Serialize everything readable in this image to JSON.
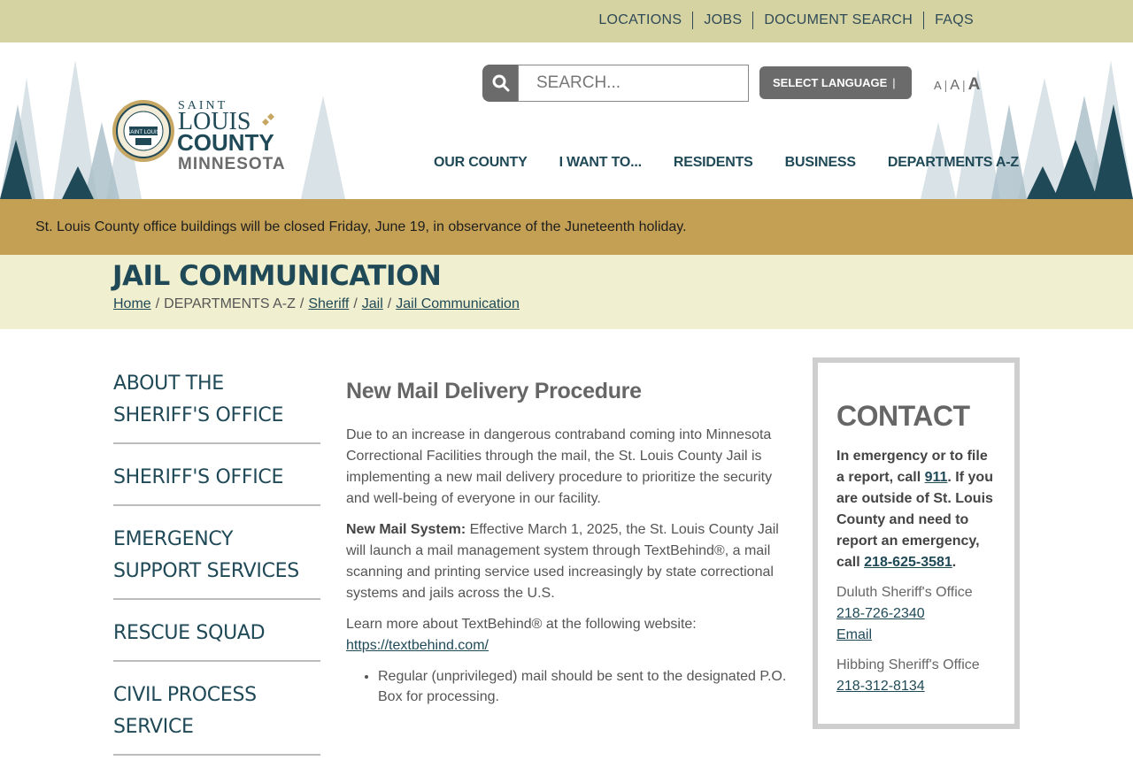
{
  "top_links": [
    "LOCATIONS",
    "JOBS",
    "DOCUMENT SEARCH",
    "FAQS"
  ],
  "logo": {
    "line1": "SAINT",
    "line2": "LOUIS",
    "line3": "COUNTY",
    "line4": "MINNESOTA",
    "seal_text": "SAINT LOUIS"
  },
  "search": {
    "placeholder": "SEARCH..."
  },
  "language": {
    "label": "SELECT LANGUAGE",
    "caret": "|"
  },
  "text_size": {
    "small": "A",
    "medium": "A",
    "large": "A",
    "sep": "|"
  },
  "nav": [
    "OUR COUNTY",
    "I WANT TO...",
    "RESIDENTS",
    "BUSINESS",
    "DEPARTMENTS A-Z"
  ],
  "alert": "St. Louis County office buildings will be closed Friday, June 19, in observance of the Juneteenth holiday.",
  "page_title": "JAIL COMMUNICATION",
  "breadcrumb": {
    "home": "Home",
    "dept": "DEPARTMENTS A-Z",
    "sheriff": "Sheriff",
    "jail": "Jail",
    "current": "Jail Communication",
    "sep": "/"
  },
  "sidebar": [
    "ABOUT THE SHERIFF'S OFFICE",
    "SHERIFF'S OFFICE",
    "EMERGENCY SUPPORT SERVICES",
    "RESCUE SQUAD",
    "CIVIL PROCESS SERVICE"
  ],
  "main": {
    "heading": "New Mail Delivery Procedure",
    "p1": "Due to an increase in dangerous contraband coming into Minnesota Correctional Facilities through the mail, the St. Louis County Jail is implementing a new mail delivery procedure to prioritize the security and well-being of everyone in our facility.",
    "p2_label": "New Mail System:",
    "p2_text": " Effective March 1, 2025, the St. Louis County Jail will launch a mail management system through TextBehind®, a mail scanning and printing service used increasingly by state correctional systems and jails across the U.S.",
    "p3_text": "Learn more about TextBehind® at the following website: ",
    "p3_link": "https://textbehind.com/",
    "bullet1": "Regular (unprivileged) mail should be sent to the designated P.O. Box for processing."
  },
  "contact": {
    "heading": "CONTACT",
    "em_text1": "In emergency or to file a report, call ",
    "em_911": "911",
    "em_text2": ". If you are outside of St. Louis County and need to report an emergency, call ",
    "em_phone": "218-625-3581",
    "em_end": ".",
    "offices": [
      {
        "name": "Duluth Sheriff's Office",
        "phone": "218-726-2340",
        "email": "Email"
      },
      {
        "name": "Hibbing Sheriff's Office",
        "phone": "218-312-8134"
      }
    ]
  },
  "colors": {
    "topbar": "#d6d3a3",
    "navy": "#1f4957",
    "alert": "#c4a054",
    "titleband": "#f0efcf",
    "button_gray": "#6b6b6b"
  },
  "icons": {
    "search": "search-icon",
    "seal": "county-seal-icon"
  }
}
